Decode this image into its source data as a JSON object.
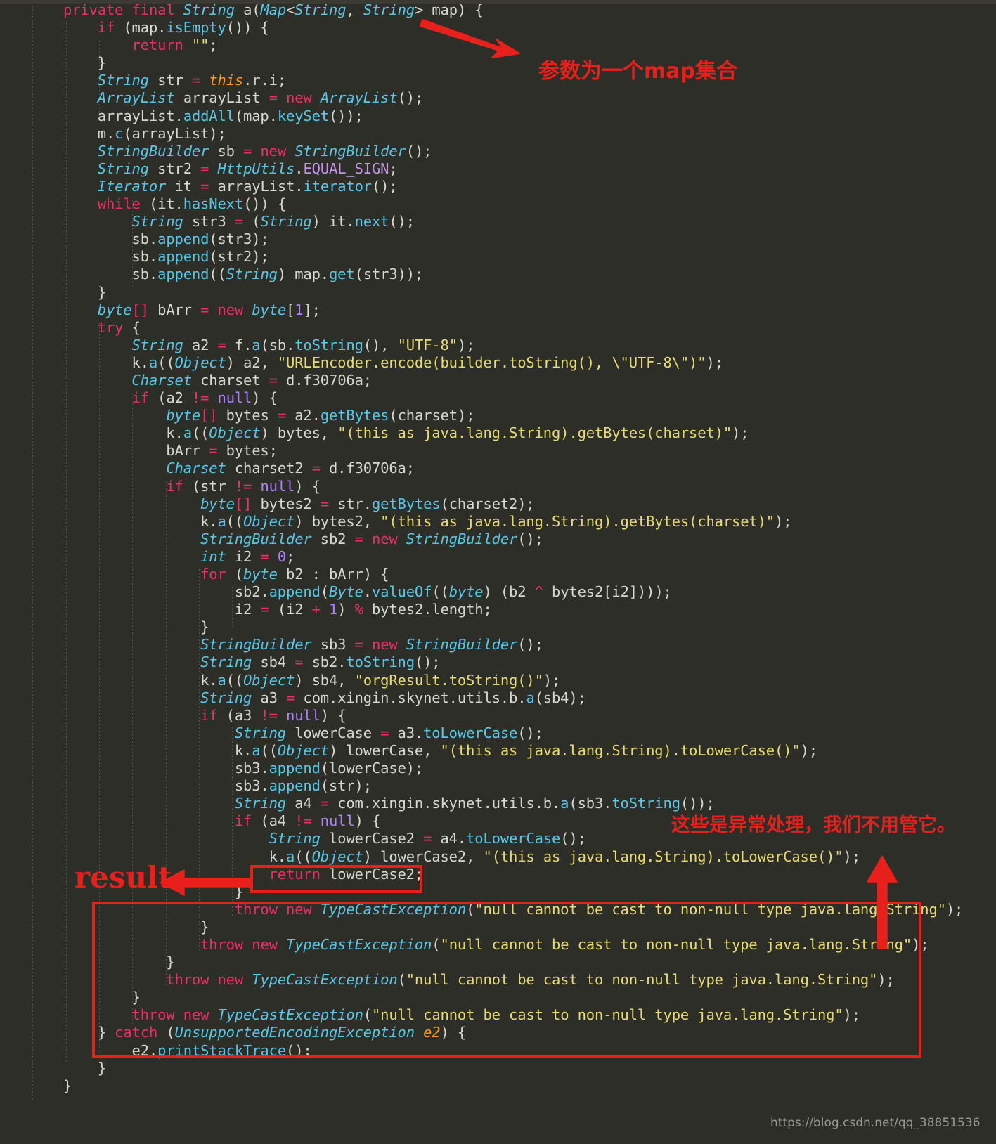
{
  "editor": {
    "background_color": "#2e2e28",
    "foreground_color": "#d8d8d2",
    "language": "Java",
    "font_size_px": 20
  },
  "palette": {
    "keyword": "#ef2e63",
    "type": "#59c8e8",
    "method": "#59c8e8",
    "string": "#e6db74",
    "number": "#ae81ff",
    "constant": "#c792ea",
    "this_keyword": "#fd971f",
    "plain": "#d8d8d2",
    "annotation_red": "#e8201c",
    "watermark_gray": "#9a9a93"
  },
  "code": {
    "lines": [
      "private final String a(Map<String, String> map) {",
      "    if (map.isEmpty()) {",
      "        return \"\";",
      "    }",
      "    String str = this.r.i;",
      "    ArrayList arrayList = new ArrayList();",
      "    arrayList.addAll(map.keySet());",
      "    m.c(arrayList);",
      "    StringBuilder sb = new StringBuilder();",
      "    String str2 = HttpUtils.EQUAL_SIGN;",
      "    Iterator it = arrayList.iterator();",
      "    while (it.hasNext()) {",
      "        String str3 = (String) it.next();",
      "        sb.append(str3);",
      "        sb.append(str2);",
      "        sb.append((String) map.get(str3));",
      "    }",
      "    byte[] bArr = new byte[1];",
      "    try {",
      "        String a2 = f.a(sb.toString(), \"UTF-8\");",
      "        k.a((Object) a2, \"URLEncoder.encode(builder.toString(), \\\"UTF-8\\\")\");",
      "        Charset charset = d.f30706a;",
      "        if (a2 != null) {",
      "            byte[] bytes = a2.getBytes(charset);",
      "            k.a((Object) bytes, \"(this as java.lang.String).getBytes(charset)\");",
      "            bArr = bytes;",
      "            Charset charset2 = d.f30706a;",
      "            if (str != null) {",
      "                byte[] bytes2 = str.getBytes(charset2);",
      "                k.a((Object) bytes2, \"(this as java.lang.String).getBytes(charset)\");",
      "                StringBuilder sb2 = new StringBuilder();",
      "                int i2 = 0;",
      "                for (byte b2 : bArr) {",
      "                    sb2.append(Byte.valueOf((byte) (b2 ^ bytes2[i2])));",
      "                    i2 = (i2 + 1) % bytes2.length;",
      "                }",
      "                StringBuilder sb3 = new StringBuilder();",
      "                String sb4 = sb2.toString();",
      "                k.a((Object) sb4, \"orgResult.toString()\");",
      "                String a3 = com.xingin.skynet.utils.b.a(sb4);",
      "                if (a3 != null) {",
      "                    String lowerCase = a3.toLowerCase();",
      "                    k.a((Object) lowerCase, \"(this as java.lang.String).toLowerCase()\");",
      "                    sb3.append(lowerCase);",
      "                    sb3.append(str);",
      "                    String a4 = com.xingin.skynet.utils.b.a(sb3.toString());",
      "                    if (a4 != null) {",
      "                        String lowerCase2 = a4.toLowerCase();",
      "                        k.a((Object) lowerCase2, \"(this as java.lang.String).toLowerCase()\");",
      "                        return lowerCase2;",
      "                    }",
      "                    throw new TypeCastException(\"null cannot be cast to non-null type java.lang.String\");",
      "                }",
      "                throw new TypeCastException(\"null cannot be cast to non-null type java.lang.String\");",
      "            }",
      "            throw new TypeCastException(\"null cannot be cast to non-null type java.lang.String\");",
      "        }",
      "        throw new TypeCastException(\"null cannot be cast to non-null type java.lang.String\");",
      "    } catch (UnsupportedEncodingException e2) {",
      "        e2.printStackTrace();",
      "    }",
      "}"
    ]
  },
  "annotations": {
    "param_note": "参数为一个map集合",
    "exception_note": "这些是异常处理，我们不用管它。",
    "result_label": "result",
    "highlight_return_line": "return lowerCase2;",
    "highlight_exception_block_start": "throw new TypeCastException(...)",
    "arrow_count": 3,
    "box_count": 2
  },
  "watermark": {
    "text": "https://blog.csdn.net/qq_38851536"
  }
}
